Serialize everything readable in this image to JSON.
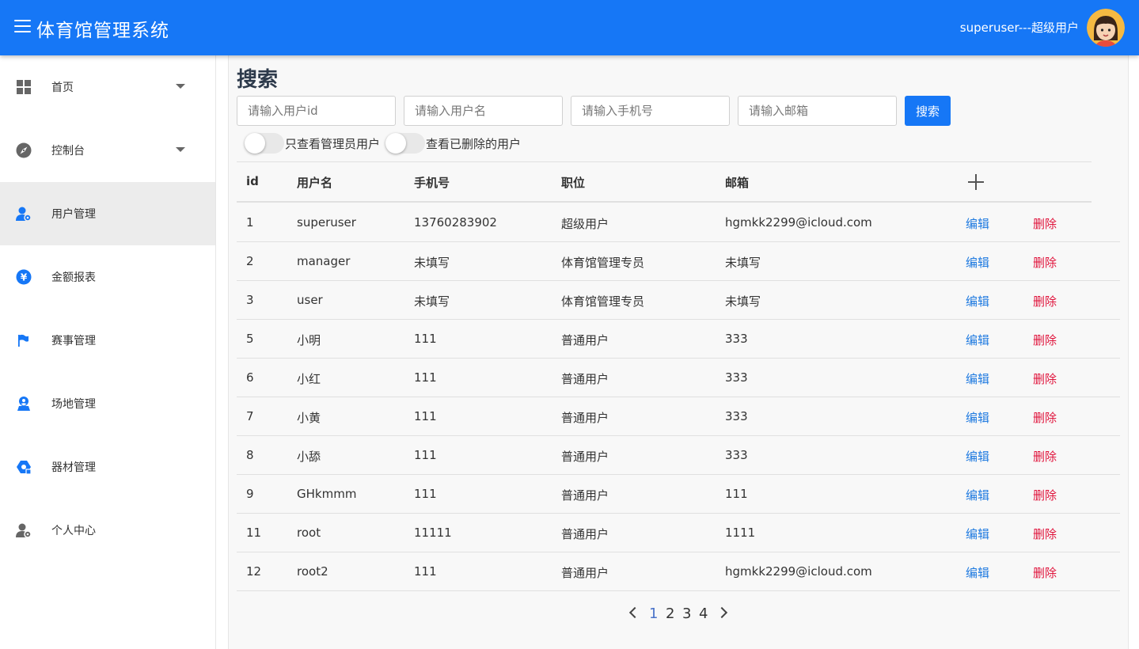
{
  "header": {
    "title": "体育馆管理系统",
    "user": "superuser---超级用户"
  },
  "sidebar": {
    "items": [
      {
        "label": "首页",
        "icon": "dashboard-grid-icon",
        "has_caret": true
      },
      {
        "label": "控制台",
        "icon": "compass-icon",
        "has_caret": true
      },
      {
        "label": "用户管理",
        "icon": "user-settings-icon",
        "active": true
      },
      {
        "label": "金额报表",
        "icon": "yen-icon"
      },
      {
        "label": "赛事管理",
        "icon": "flag-icon"
      },
      {
        "label": "场地管理",
        "icon": "location-user-icon"
      },
      {
        "label": "器材管理",
        "icon": "equipment-icon"
      },
      {
        "label": "个人中心",
        "icon": "person-settings-icon"
      }
    ]
  },
  "search": {
    "title": "搜索",
    "id_placeholder": "请输入用户id",
    "name_placeholder": "请输入用户名",
    "phone_placeholder": "请输入手机号",
    "email_placeholder": "请输入邮箱",
    "button": "搜索",
    "toggle_admin": "只查看管理员用户",
    "toggle_deleted": "查看已删除的用户"
  },
  "table": {
    "headers": {
      "id": "id",
      "username": "用户名",
      "phone": "手机号",
      "position": "职位",
      "email": "邮箱"
    },
    "edit_label": "编辑",
    "delete_label": "删除",
    "rows": [
      {
        "id": "1",
        "username": "superuser",
        "phone": "13760283902",
        "position": "超级用户",
        "email": "hgmkk2299@icloud.com"
      },
      {
        "id": "2",
        "username": "manager",
        "phone": "未填写",
        "position": "体育馆管理专员",
        "email": "未填写"
      },
      {
        "id": "3",
        "username": "user",
        "phone": "未填写",
        "position": "体育馆管理专员",
        "email": "未填写"
      },
      {
        "id": "5",
        "username": "小明",
        "phone": "111",
        "position": "普通用户",
        "email": "333"
      },
      {
        "id": "6",
        "username": "小红",
        "phone": "111",
        "position": "普通用户",
        "email": "333"
      },
      {
        "id": "7",
        "username": "小黄",
        "phone": "111",
        "position": "普通用户",
        "email": "333"
      },
      {
        "id": "8",
        "username": "小舔",
        "phone": "111",
        "position": "普通用户",
        "email": "333"
      },
      {
        "id": "9",
        "username": "GHkmmm",
        "phone": "111",
        "position": "普通用户",
        "email": "111"
      },
      {
        "id": "11",
        "username": "root",
        "phone": "11111",
        "position": "普通用户",
        "email": "1111"
      },
      {
        "id": "12",
        "username": "root2",
        "phone": "111",
        "position": "普通用户",
        "email": "hgmkk2299@icloud.com"
      }
    ]
  },
  "pagination": {
    "current": 1,
    "pages": [
      "1",
      "2",
      "3",
      "4"
    ]
  },
  "colors": {
    "primary": "#1677f6",
    "link": "#1f7ae0",
    "danger": "#e0143c"
  }
}
